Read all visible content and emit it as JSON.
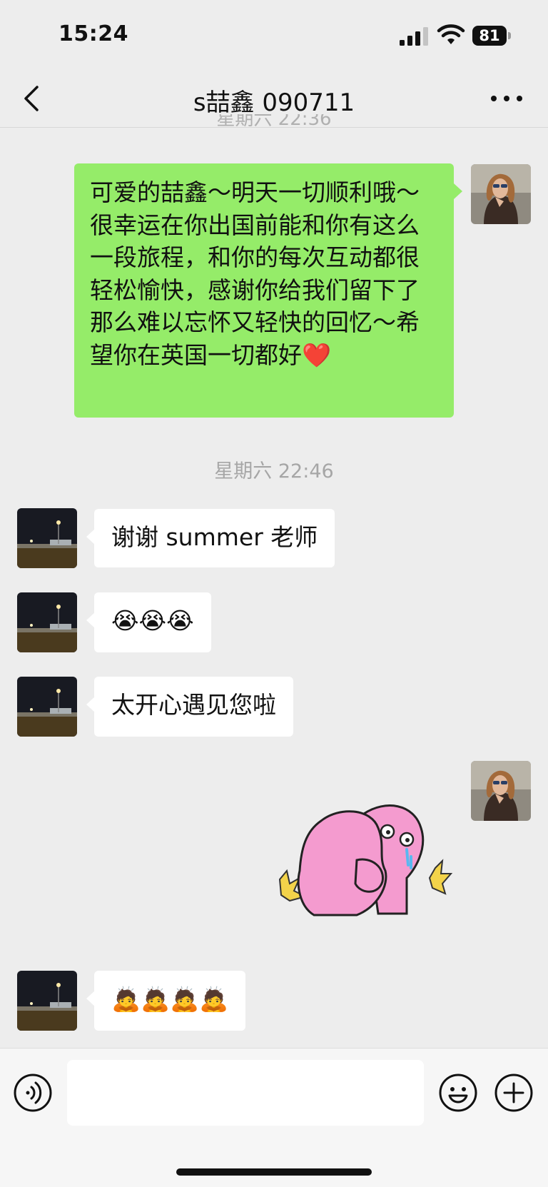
{
  "status_bar": {
    "time": "15:24",
    "battery_level": "81"
  },
  "header": {
    "title": "s喆鑫 090711"
  },
  "messages": {
    "clipped_timestamp": "星期六 22:36",
    "outgoing_1": "可爱的喆鑫～明天一切顺利哦～很幸运在你出国前能和你有这么一段旅程，和你的每次互动都很轻松愉快，感谢你给我们留下了那么难以忘怀又轻快的回忆～希望你在英国一切都好❤️",
    "timestamp_2": "星期六 22:46",
    "incoming_1": "谢谢 summer 老师",
    "incoming_2": "😭😭😭",
    "incoming_3": "太开心遇见您啦",
    "incoming_4": "🙇🙇🙇🙇"
  },
  "input": {
    "placeholder": ""
  },
  "colors": {
    "outgoing_bubble": "#95ec69",
    "incoming_bubble": "#ffffff",
    "chat_background": "#ededed"
  }
}
